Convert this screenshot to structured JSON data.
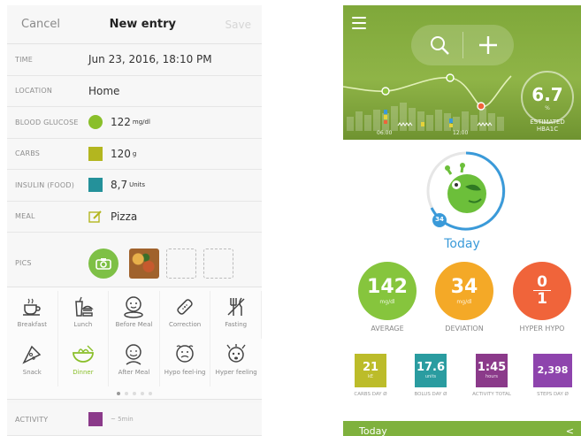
{
  "left": {
    "nav": {
      "cancel": "Cancel",
      "title": "New entry",
      "save": "Save"
    },
    "rows": {
      "time": {
        "label": "TIME",
        "value": "Jun 23, 2016, 18:10 PM"
      },
      "location": {
        "label": "LOCATION",
        "value": "Home"
      },
      "glucose": {
        "label": "BLOOD GLUCOSE",
        "value": "122",
        "unit": "mg/dl",
        "color": "#8abf2a"
      },
      "carbs": {
        "label": "CARBS",
        "value": "120",
        "unit": "g",
        "color": "#b3b61f"
      },
      "insulin": {
        "label": "INSULIN (FOOD)",
        "value": "8,7",
        "unit": "Units",
        "color": "#24919a"
      },
      "meal": {
        "label": "MEAL",
        "value": "Pizza",
        "icon": "pencil-note-icon"
      },
      "pics": {
        "label": "PICS"
      },
      "activity": {
        "label": "ACTIVITY",
        "value": "~ 5min",
        "color": "#8b3a8a"
      }
    },
    "meals": [
      {
        "label": "Breakfast",
        "icon": "coffee-cup-icon"
      },
      {
        "label": "Lunch",
        "icon": "burger-drink-icon"
      },
      {
        "label": "Before Meal",
        "icon": "face-plate-icon"
      },
      {
        "label": "Correction",
        "icon": "bandage-icon"
      },
      {
        "label": "Fasting",
        "icon": "fork-knife-icon"
      },
      {
        "label": "Snack",
        "icon": "pizza-slice-icon"
      },
      {
        "label": "Dinner",
        "icon": "bowl-icon",
        "selected": true
      },
      {
        "label": "After Meal",
        "icon": "face-full-icon"
      },
      {
        "label": "Hypo feel-ing",
        "icon": "face-sad-icon"
      },
      {
        "label": "Hyper feeling",
        "icon": "face-hyper-icon"
      }
    ]
  },
  "right": {
    "hba1c": {
      "value": "6.7",
      "unit": "%",
      "label": "ESTIMATED HBA1C"
    },
    "time_labels": [
      "06:00",
      "12:00"
    ],
    "today": "Today",
    "stats": [
      {
        "value": "142",
        "unit": "mg/dl",
        "label": "AVERAGE",
        "color": "#86c53d"
      },
      {
        "value": "34",
        "unit": "mg/dl",
        "label": "DEVIATION",
        "color": "#f4a927"
      },
      {
        "value_top": "0",
        "value_bottom": "1",
        "label": "HYPER HYPO",
        "color": "#f0643a"
      }
    ],
    "tiles": [
      {
        "value": "21",
        "unit": "kE",
        "label": "CARBS DAY Ø",
        "color": "#bcbc2a"
      },
      {
        "value": "17.6",
        "unit": "units",
        "label": "BOLUS DAY Ø",
        "color": "#2a9ca0"
      },
      {
        "value": "1:45",
        "unit": "hours",
        "label": "ACTIVITY TOTAL",
        "color": "#8b3a8a"
      },
      {
        "value": "2,398",
        "unit": "",
        "label": "STEPS DAY Ø",
        "color": "#8e44ad"
      }
    ],
    "mascot_badge": "34",
    "bottom_bar": {
      "label": "Today",
      "chevron": "<"
    }
  }
}
